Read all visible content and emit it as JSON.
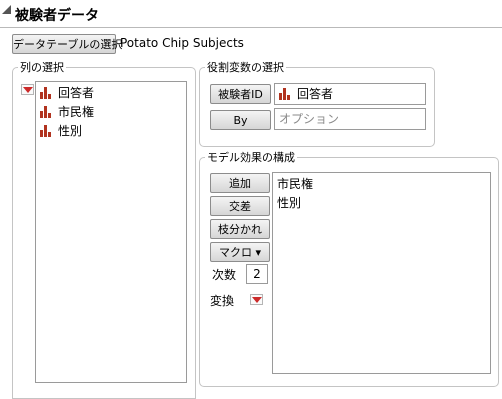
{
  "header": {
    "title": "被験者データ"
  },
  "data_table": {
    "button_label": "データテーブルの選択",
    "name": "Potato Chip Subjects"
  },
  "columns": {
    "group_label": "列の選択",
    "items": [
      {
        "label": "回答者"
      },
      {
        "label": "市民権"
      },
      {
        "label": "性別"
      }
    ]
  },
  "roles": {
    "group_label": "役割変数の選択",
    "subject_id": {
      "button_label": "被験者ID",
      "value": "回答者"
    },
    "by": {
      "button_label": "By",
      "placeholder": "オプション"
    }
  },
  "model": {
    "group_label": "モデル効果の構成",
    "add_label": "追加",
    "cross_label": "交差",
    "nest_label": "枝分かれ",
    "macro_label": "マクロ ▾",
    "degree_label": "次数",
    "degree_value": "2",
    "transform_label": "変換",
    "effects": [
      {
        "label": "市民権"
      },
      {
        "label": "性別"
      }
    ]
  },
  "colors": {
    "accent_red": "#cc2a2a",
    "icon_bar": "#b1331f"
  }
}
